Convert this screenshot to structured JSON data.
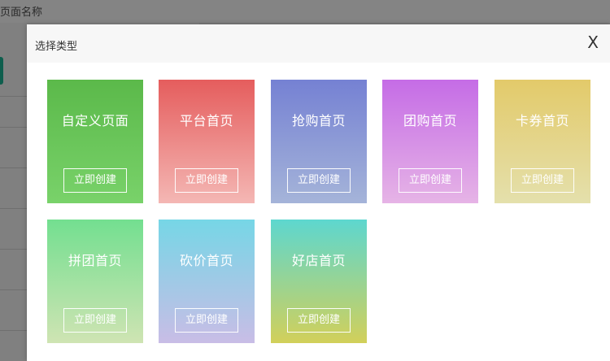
{
  "background": {
    "title": "页面名称"
  },
  "modal": {
    "title": "选择类型",
    "close_label": "X"
  },
  "cards": [
    {
      "label": "自定义页面",
      "button": "立即创建"
    },
    {
      "label": "平台首页",
      "button": "立即创建"
    },
    {
      "label": "抢购首页",
      "button": "立即创建"
    },
    {
      "label": "团购首页",
      "button": "立即创建"
    },
    {
      "label": "卡券首页",
      "button": "立即创建"
    },
    {
      "label": "拼团首页",
      "button": "立即创建"
    },
    {
      "label": "砍价首页",
      "button": "立即创建"
    },
    {
      "label": "好店首页",
      "button": "立即创建"
    }
  ],
  "colors": {
    "custom": [
      "#5bb94a",
      "#79d26a"
    ],
    "platform": [
      "#e55d5d",
      "#f4b7b4"
    ],
    "flash": [
      "#7581d3",
      "#a5b4d9"
    ],
    "group": [
      "#c56ce6",
      "#e6b4e6"
    ],
    "coupon": [
      "#e3ca6a",
      "#e4e0ac"
    ],
    "pin": [
      "#73df90",
      "#cfe4b3"
    ],
    "bargain": [
      "#76d6e6",
      "#c9bde6"
    ],
    "shop": [
      "#5dd7cf",
      "#d2d05a"
    ]
  }
}
